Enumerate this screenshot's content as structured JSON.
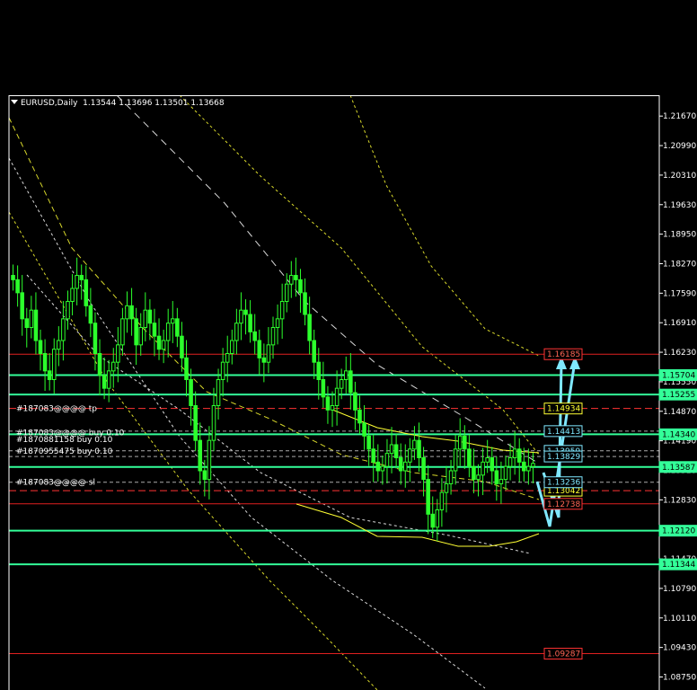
{
  "header": {
    "symbol_timeframe": "EURUSD,Daily",
    "ohlc": "1.13544 1.13696 1.13501 1.13668"
  },
  "colors": {
    "background": "#000000",
    "candle": "#2cff2c",
    "support_line": "#33ff99",
    "resistance_line": "#e02020",
    "tp_line": "#ffff00",
    "arrow": "#7fe8ff",
    "axis_text": "#ffffff",
    "ma_line": "#ffff33"
  },
  "price_axis": {
    "ticks": [
      "1.21670",
      "1.20990",
      "1.20310",
      "1.19630",
      "1.18950",
      "1.18270",
      "1.17590",
      "1.16910",
      "1.16230",
      "1.15550",
      "1.14870",
      "1.14190",
      "1.13510",
      "1.12830",
      "1.12150",
      "1.11470",
      "1.10790",
      "1.10110",
      "1.09430",
      "1.08750"
    ]
  },
  "chart_data": {
    "type": "candlestick",
    "title": "EURUSD,Daily",
    "ylim": [
      1.0845,
      1.2215
    ],
    "ohlc_last": [
      1.13544,
      1.13696,
      1.13501,
      1.13668
    ],
    "support_levels": [
      {
        "price": 1.15704,
        "label": "1.15704"
      },
      {
        "price": 1.15255,
        "label": "1.15255"
      },
      {
        "price": 1.1434,
        "label": "1.14340"
      },
      {
        "price": 1.13587,
        "label": "1.13587"
      },
      {
        "price": 1.1212,
        "label": "1.12120"
      },
      {
        "price": 1.11344,
        "label": "1.11344"
      }
    ],
    "resistance_levels": [
      {
        "price": 1.16185,
        "label": "1.16185"
      },
      {
        "price": 1.12738,
        "label": "1.12738"
      },
      {
        "price": 1.09287,
        "label": "1.09287"
      }
    ],
    "target_levels": [
      {
        "price": 1.14934,
        "label": "1.14934"
      },
      {
        "price": 1.13042,
        "label": "1.13042"
      }
    ],
    "order_levels": [
      {
        "price": 1.14413,
        "label": "1.14413"
      },
      {
        "price": 1.13959,
        "label": "1.13959"
      },
      {
        "price": 1.13829,
        "label": "1.13829"
      },
      {
        "price": 1.13236,
        "label": "1.13236"
      }
    ],
    "order_labels": [
      {
        "price": 1.14934,
        "text": "#187083@@@@ tp"
      },
      {
        "price": 1.1438,
        "text": "#187083@@@@ buy 0.10"
      },
      {
        "price": 1.1422,
        "text": "#1870881158 buy 0.10"
      },
      {
        "price": 1.13959,
        "text": "#1870955475 buy 0.10"
      },
      {
        "price": 1.13236,
        "text": "#187083@@@@ sl"
      }
    ],
    "close_series": [
      1.179,
      1.176,
      1.17,
      1.168,
      1.172,
      1.165,
      1.162,
      1.158,
      1.156,
      1.163,
      1.165,
      1.17,
      1.174,
      1.177,
      1.18,
      1.179,
      1.173,
      1.169,
      1.162,
      1.157,
      1.154,
      1.158,
      1.16,
      1.164,
      1.17,
      1.173,
      1.17,
      1.164,
      1.168,
      1.172,
      1.169,
      1.166,
      1.163,
      1.165,
      1.169,
      1.17,
      1.166,
      1.161,
      1.156,
      1.15,
      1.142,
      1.135,
      1.133,
      1.142,
      1.15,
      1.156,
      1.16,
      1.162,
      1.165,
      1.169,
      1.172,
      1.171,
      1.167,
      1.165,
      1.161,
      1.16,
      1.164,
      1.168,
      1.17,
      1.174,
      1.178,
      1.18,
      1.179,
      1.176,
      1.171,
      1.165,
      1.16,
      1.156,
      1.152,
      1.149,
      1.15,
      1.154,
      1.156,
      1.158,
      1.153,
      1.149,
      1.146,
      1.143,
      1.14,
      1.137,
      1.135,
      1.136,
      1.139,
      1.141,
      1.138,
      1.135,
      1.137,
      1.14,
      1.142,
      1.138,
      1.133,
      1.125,
      1.122,
      1.126,
      1.13,
      1.132,
      1.135,
      1.14,
      1.143,
      1.14,
      1.136,
      1.133,
      1.134,
      1.137,
      1.138,
      1.135,
      1.132,
      1.133,
      1.136,
      1.138,
      1.14,
      1.137,
      1.135,
      1.136,
      1.1367
    ]
  }
}
